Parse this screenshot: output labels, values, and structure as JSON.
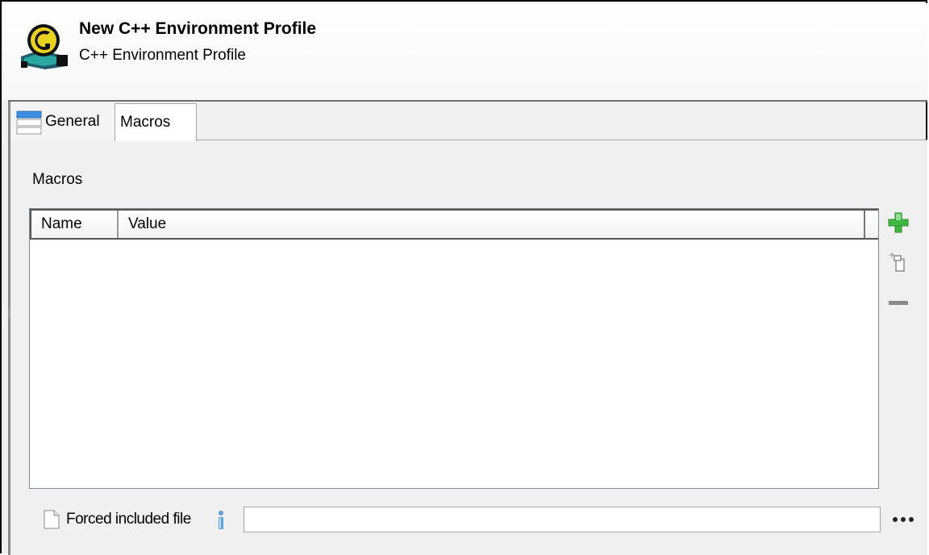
{
  "header": {
    "title": "New C++ Environment Profile",
    "subtitle": "C++ Environment Profile",
    "logo_icon": "c-environment-logo-icon"
  },
  "tabs": [
    {
      "label": "General",
      "icon": "general-tab-icon",
      "selected": false
    },
    {
      "label": "Macros",
      "selected": true
    }
  ],
  "macros": {
    "section_label": "Macros",
    "columns": [
      "Name",
      "Value"
    ],
    "rows": [],
    "buttons": {
      "add_icon": "add-plus-icon",
      "copy_icon": "copy-icon",
      "remove_icon": "remove-minus-icon"
    }
  },
  "forced_include": {
    "label": "Forced included file",
    "value": "",
    "browse_icon": "ellipsis-icon",
    "info_icon": "info-icon"
  },
  "colors": {
    "accent_green": "#3fb83f",
    "remove_gray": "#8a8a8a"
  }
}
